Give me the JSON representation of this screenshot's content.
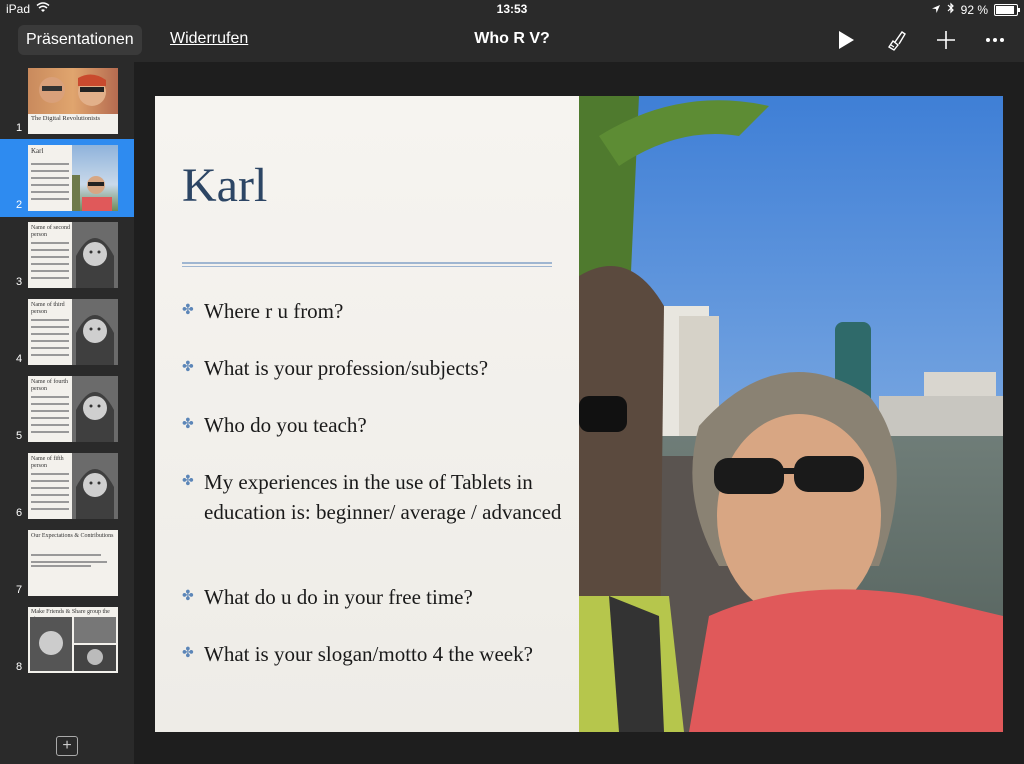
{
  "status": {
    "device": "iPad",
    "time": "13:53",
    "battery": "92 %",
    "battery_fraction": 0.92
  },
  "toolbar": {
    "presentations_label": "Präsentationen",
    "undo_label": "Widerrufen",
    "doc_title": "Who R V?",
    "icons": [
      "play-icon",
      "format-brush-icon",
      "add-icon",
      "more-icon"
    ]
  },
  "sidebar": {
    "slides": [
      {
        "num": "1",
        "title": "The Digital Revolutionists",
        "kind": "photo-title"
      },
      {
        "num": "2",
        "title": "Karl",
        "kind": "selected"
      },
      {
        "num": "3",
        "title": "Name of second person"
      },
      {
        "num": "4",
        "title": "Name of third person"
      },
      {
        "num": "5",
        "title": "Name of fourth person"
      },
      {
        "num": "6",
        "title": "Name of fifth person"
      },
      {
        "num": "7",
        "title": "Our Expectations & Contributions",
        "kind": "text"
      },
      {
        "num": "8",
        "title": "Make Friends & Share group the pics",
        "kind": "photos"
      }
    ],
    "selected_index": 1
  },
  "slide": {
    "title": "Karl",
    "bullets": [
      "Where r u from?",
      "What is your profession/subjects?",
      "Who do you teach?",
      "My experiences in the use of Tablets in education is: beginner/ average / advanced",
      "What do u do in your free time?",
      "What is your slogan/motto 4 the week?"
    ]
  },
  "colors": {
    "accent": "#2e8bf0",
    "title_blue": "#2c4564",
    "bullet_blue": "#5c86b8"
  }
}
